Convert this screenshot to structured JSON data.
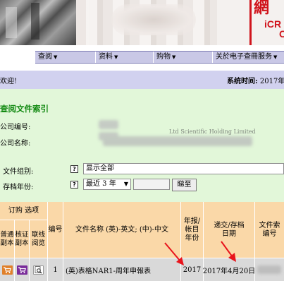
{
  "banner": {
    "logo_char": "網",
    "logo_text_1": "iCR",
    "logo_text_2": "C"
  },
  "nav": {
    "items": [
      {
        "label": "查阅"
      },
      {
        "label": "资料"
      },
      {
        "label": "购物"
      },
      {
        "label": "关於电子查冊服务"
      }
    ]
  },
  "header": {
    "welcome": "欢迎!",
    "system_time_label": "系统时间:",
    "system_time_value": "2017年"
  },
  "page": {
    "title": "查阅文件索引",
    "company_no_label": "公司编号:",
    "company_name_label": "公司名称:",
    "company_name_partial": "Ltd Scientific Holding Limited",
    "doc_group_label": "文件组别:",
    "archive_year_label": "存档年份:",
    "doc_group_value": "显示全部",
    "archive_year_value": "最近 3 年",
    "search_button": "睇至",
    "help_icon": "?"
  },
  "table": {
    "headers": {
      "order_options": "订购 选项",
      "normal_copy": "普通副本",
      "certified_copy": "核证副本",
      "online_view": "联线阅览",
      "number": "编号",
      "doc_name": "文件名称 (英)-英文; (中)-中文",
      "year": "年报/帐目年份",
      "submit_date": "递交/存档日期",
      "doc_no": "文件索编号"
    },
    "rows": [
      {
        "number": "1",
        "doc_name": "(英)表格NAR1-周年申報表",
        "year": "2017",
        "submit_date": "2017年4月20日"
      }
    ]
  },
  "colors": {
    "nav_bg": "#c9c8e6",
    "sysbar_bg": "#d1d1ef",
    "main_bg": "#e2f7d9",
    "title_green": "#128a12",
    "header_orange": "#fad8a8",
    "annotation_red": "#e8141c"
  },
  "icons": [
    "cart-icon",
    "certified-cart-icon",
    "magnifier-icon",
    "help-icon"
  ]
}
